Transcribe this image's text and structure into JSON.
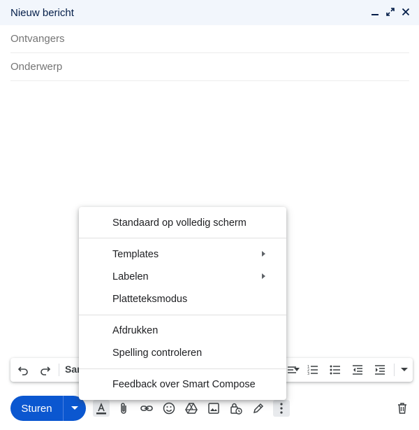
{
  "window": {
    "title": "Nieuw bericht",
    "controls": [
      "minimize-icon",
      "expand-icon",
      "close-icon"
    ]
  },
  "fields": {
    "to_placeholder": "Ontvangers",
    "subject_placeholder": "Onderwerp"
  },
  "toolbar": {
    "font_name": "Sar"
  },
  "send": {
    "label": "Sturen"
  },
  "menu": {
    "items": [
      {
        "label": "Standaard op volledig scherm",
        "submenu": false
      },
      {
        "label": "Templates",
        "submenu": true
      },
      {
        "label": "Labelen",
        "submenu": true
      },
      {
        "label": "Platteteksmodus",
        "submenu": false
      },
      {
        "label": "Afdrukken",
        "submenu": false
      },
      {
        "label": "Spelling controleren",
        "submenu": false
      },
      {
        "label": "Feedback over Smart Compose",
        "submenu": false
      }
    ]
  },
  "colors": {
    "send_button": "#0b57d0",
    "titlebar": "#f2f6fc",
    "title_text": "#041e49"
  }
}
